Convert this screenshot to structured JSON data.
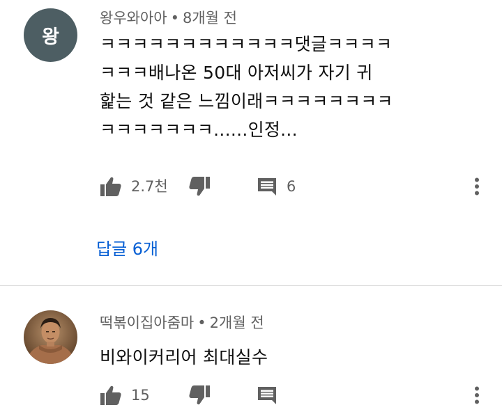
{
  "comments": [
    {
      "avatar_letter": "왕",
      "author": "왕우와아아",
      "separator": "•",
      "time": "8개월 전",
      "text": "ㅋㅋㅋㅋㅋㅋㅋㅋㅋㅋㅋㅋ댓글ㅋㅋㅋㅋ\nㅋㅋㅋ배나온 50대 아저씨가 자기 귀\n핥는 것 같은 느낌이래ㅋㅋㅋㅋㅋㅋㅋㅋ\nㅋㅋㅋㅋㅋㅋㅋ......인정...",
      "likes": "2.7천",
      "reply_count": "6",
      "replies_link": "답글 6개"
    },
    {
      "author": "떡볶이집아줌마",
      "separator": "•",
      "time": "2개월 전",
      "text": "비와이커리어 최대실수",
      "likes": "15"
    }
  ],
  "icons": {
    "like": "thumbs-up-icon",
    "dislike": "thumbs-down-icon",
    "reply": "comment-icon",
    "more": "more-vertical-icon"
  },
  "colors": {
    "avatar_bg": "#4d5e63",
    "link": "#065fd4",
    "meta_text": "#606060",
    "icon": "#606060"
  }
}
